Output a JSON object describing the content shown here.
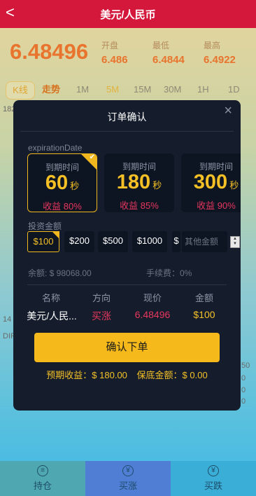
{
  "header": {
    "back_icon": "chevron-left-icon",
    "back_glyph": "<",
    "title": "美元/人民币"
  },
  "quote": {
    "price": "6.48496",
    "open_label": "开盘",
    "open": "6.486",
    "low_label": "最低",
    "low": "6.4844",
    "high_label": "最高",
    "high": "6.4922"
  },
  "chart_tabs": [
    "K线",
    "走势",
    "1M",
    "5M",
    "15M",
    "30M",
    "1H",
    "1D"
  ],
  "background_fragments": {
    "left_182": "182",
    "left_14": "14",
    "left_dir": "DIR",
    "right_50": "50",
    "right_0a": "0",
    "right_0b": "0",
    "right_0c": "0"
  },
  "modal": {
    "title": "订单确认",
    "close_glyph": "×",
    "expiration_label": "expirationDate",
    "cards": [
      {
        "label": "到期时间",
        "value": "60",
        "unit": "秒",
        "profit": "收益 80%"
      },
      {
        "label": "到期时间",
        "value": "180",
        "unit": "秒",
        "profit": "收益 85%"
      },
      {
        "label": "到期时间",
        "value": "300",
        "unit": "秒",
        "profit": "收益 90%"
      }
    ],
    "amount_label": "投资金额",
    "amounts": [
      "$100",
      "$200",
      "$500",
      "$1000",
      "$"
    ],
    "other_placeholder": "其他金额",
    "balance": "余额: $ 98068.00",
    "fee": "手续费：0%",
    "columns": [
      "名称",
      "方向",
      "现价",
      "金额"
    ],
    "row": {
      "name": "美元/人民...",
      "direction": "买涨",
      "price": "6.48496",
      "amount": "$100"
    },
    "confirm_label": "确认下单",
    "expected": "预期收益：$ 180.00",
    "guarantee": "保底金额：$ 0.00"
  },
  "bottom_nav": [
    {
      "label": "持仓",
      "icon": "position-icon"
    },
    {
      "label": "买涨",
      "icon": "yen-up-icon"
    },
    {
      "label": "买跌",
      "icon": "yen-down-icon"
    }
  ],
  "colors": {
    "header": "#d4183c",
    "accent": "#f5c025",
    "up_red": "#e8365d"
  }
}
